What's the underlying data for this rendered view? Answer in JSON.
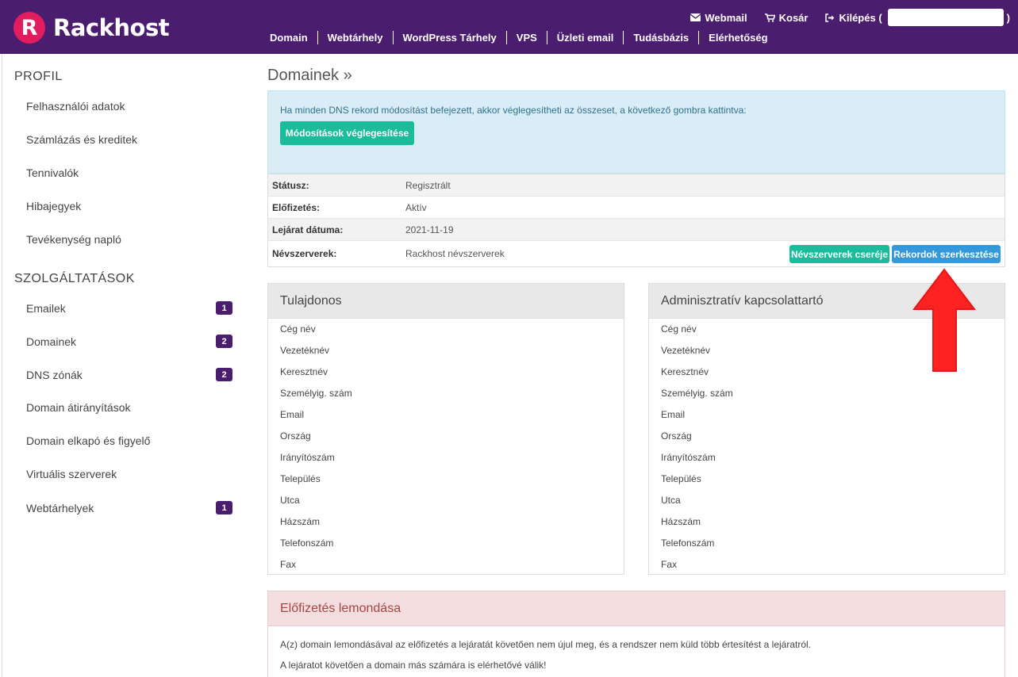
{
  "header": {
    "logo_letter": "R",
    "logo_text": "Rackhost",
    "toplinks": {
      "webmail": "Webmail",
      "cart": "Kosár",
      "logout": "Kilépés (",
      "logout_close": ")"
    },
    "nav": [
      "Domain",
      "Webtárhely",
      "WordPress Tárhely",
      "VPS",
      "Üzleti email",
      "Tudásbázis",
      "Elérhetőség"
    ]
  },
  "sidebar": {
    "profile_title": "PROFIL",
    "profile_items": [
      "Felhasználói adatok",
      "Számlázás és kreditek",
      "Tennivalók",
      "Hibajegyek",
      "Tevékenység napló"
    ],
    "services_title": "SZOLGÁLTATÁSOK",
    "service_items": [
      {
        "label": "Emailek",
        "badge": "1"
      },
      {
        "label": "Domainek",
        "badge": "2"
      },
      {
        "label": "DNS zónák",
        "badge": "2"
      },
      {
        "label": "Domain átirányítások",
        "badge": ""
      },
      {
        "label": "Domain elkapó és figyelő",
        "badge": ""
      },
      {
        "label": "Virtuális szerverek",
        "badge": ""
      },
      {
        "label": "Webtárhelyek",
        "badge": "1"
      }
    ]
  },
  "main": {
    "title": "Domainek »",
    "alert_text": "Ha minden DNS rekord módosítást befejezett, akkor véglegesítheti az összeset, a következő gombra kattintva:",
    "finalize_button": "Módosítások véglegesítése",
    "info": [
      {
        "key": "Státusz:",
        "value": "Regisztrált"
      },
      {
        "key": "Előfizetés:",
        "value": "Aktív"
      },
      {
        "key": "Lejárat dátuma:",
        "value": "2021-11-19"
      },
      {
        "key": "Névszerverek:",
        "value": "Rackhost névszerverek"
      }
    ],
    "ns_change_button": "Névszerverek cseréje",
    "records_edit_button": "Rekordok szerkesztése",
    "owner_panel_title": "Tulajdonos",
    "admin_panel_title": "Adminisztratív kapcsolattartó",
    "contact_fields": [
      "Cég név",
      "Vezetéknév",
      "Keresztnév",
      "Személyig. szám",
      "Email",
      "Ország",
      "Irányítószám",
      "Település",
      "Utca",
      "Házszám",
      "Telefonszám",
      "Fax"
    ],
    "cancel_title": "Előfizetés lemondása",
    "cancel_text_1": "A(z) domain lemondásával az előfizetés a lejáratát követően nem újul meg, és a rendszer nem küld több értesítést a lejáratról.",
    "cancel_text_2": "A lejáratot követően a domain más számára is elérhetővé válik!"
  },
  "colors": {
    "brand": "#4b1d6e",
    "logo": "#e21d5f",
    "green": "#1abc9c",
    "blue": "#3498db",
    "arrow": "#ff2222"
  }
}
